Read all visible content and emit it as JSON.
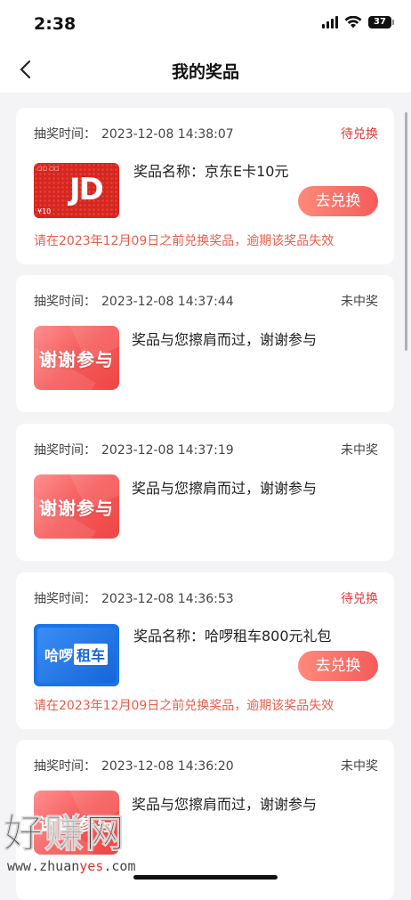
{
  "status_bar": {
    "time": "2:38",
    "battery": "37"
  },
  "nav": {
    "title": "我的奖品"
  },
  "draw_time_label": "抽奖时间：",
  "records": [
    {
      "draw_time": "2023-12-08 14:38:07",
      "status": "待兑换",
      "prize_name": "奖品名称：京东E卡10元",
      "redeem_label": "去兑换",
      "deadline": "请在2023年12月09日之前兑换奖品，逾期该奖品失效",
      "image": "jd-ecard"
    },
    {
      "draw_time": "2023-12-08 14:37:44",
      "status": "未中奖",
      "message": "奖品与您擦肩而过，谢谢参与",
      "image_text": "谢谢参与"
    },
    {
      "draw_time": "2023-12-08 14:37:19",
      "status": "未中奖",
      "message": "奖品与您擦肩而过，谢谢参与",
      "image_text": "谢谢参与"
    },
    {
      "draw_time": "2023-12-08 14:36:53",
      "status": "待兑换",
      "prize_name": "奖品名称：哈啰租车800元礼包",
      "redeem_label": "去兑换",
      "deadline": "请在2023年12月09日之前兑换奖品，逾期该奖品失效",
      "image": "hello-car-rental",
      "image_text_a": "哈啰",
      "image_text_b": "租车"
    },
    {
      "draw_time": "2023-12-08 14:36:20",
      "status": "未中奖",
      "message": "奖品与您擦肩而过，谢谢参与",
      "image_text": "谢谢参与"
    }
  ],
  "jd_card": {
    "logo": "JD",
    "value": "¥10"
  },
  "watermark": {
    "big": "好赚网",
    "small_a": "www.zhuan",
    "small_b": "yes",
    "small_c": ".com"
  },
  "colors": {
    "accent": "#f45b5b",
    "pending": "#e53935",
    "deadline": "#ea5d4a"
  }
}
